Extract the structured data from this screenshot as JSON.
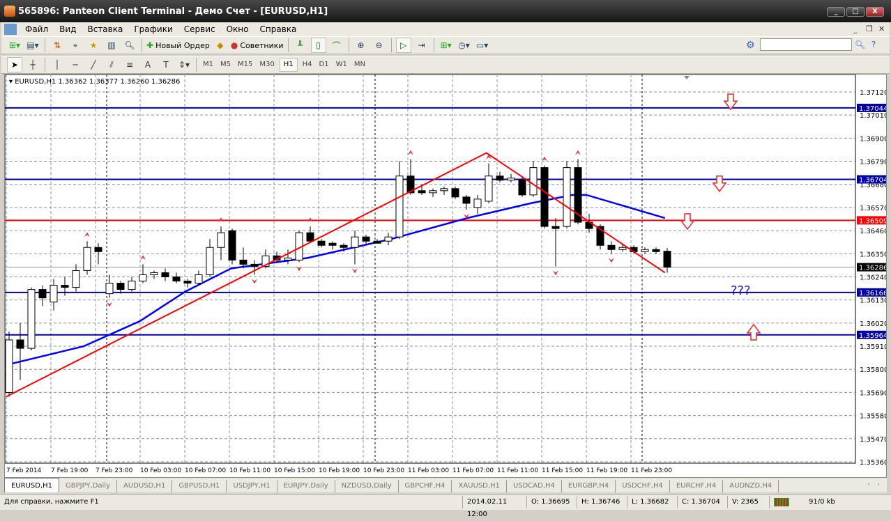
{
  "window": {
    "title": "565896: Panteon Client Terminal - Демо Счет - [EURUSD,H1]",
    "min": "_",
    "max": "□",
    "close": "X"
  },
  "menu": [
    "Файл",
    "Вид",
    "Вставка",
    "Графики",
    "Сервис",
    "Окно",
    "Справка"
  ],
  "toolbar": {
    "new_order": "Новый Ордер",
    "experts": "Советники"
  },
  "timeframes": [
    "M1",
    "M5",
    "M15",
    "M30",
    "H1",
    "H4",
    "D1",
    "W1",
    "MN"
  ],
  "active_timeframe": "H1",
  "chart_header": "EURUSD,H1  1.36362 1.36377 1.36260 1.36286",
  "question_text": "???",
  "tabs": [
    "EURUSD,H1",
    "GBPJPY,Daily",
    "AUDUSD,H1",
    "GBPUSD,H1",
    "USDJPY,H1",
    "EURJPY,Daily",
    "NZDUSD,Daily",
    "GBPCHF,H4",
    "XAUUSD,H1",
    "USDCAD,H4",
    "EURGBP,H4",
    "USDCHF,H4",
    "EURCHF,H4",
    "AUDNZD,H4"
  ],
  "status": {
    "help": "Для справки, нажмите F1",
    "time": "2014.02.11 12:00",
    "open": "O: 1.36695",
    "high": "H: 1.36746",
    "low": "L: 1.36682",
    "close": "C: 1.36704",
    "volume": "V: 2365",
    "traffic": "91/0 kb"
  },
  "colors": {
    "bull": "#ffffff",
    "bear": "#000000",
    "ma": "#0000ff",
    "trend": "#ff0000",
    "level_blue": "#0000aa",
    "level_red": "#ff0000"
  },
  "chart_data": {
    "type": "candlestick",
    "symbol": "EURUSD",
    "timeframe": "H1",
    "ylim": [
      1.3533,
      1.372
    ],
    "y_ticks": [
      "1.37120",
      "1.37010",
      "1.36900",
      "1.36790",
      "1.36680",
      "1.36570",
      "1.36460",
      "1.36350",
      "1.36240",
      "1.36130",
      "1.36020",
      "1.35910",
      "1.35800",
      "1.35690",
      "1.35580",
      "1.35470",
      "1.35360"
    ],
    "x_labels": [
      "7 Feb 2014",
      "7 Feb 19:00",
      "7 Feb 23:00",
      "10 Feb 03:00",
      "10 Feb 07:00",
      "10 Feb 11:00",
      "10 Feb 15:00",
      "10 Feb 19:00",
      "10 Feb 23:00",
      "11 Feb 03:00",
      "11 Feb 07:00",
      "11 Feb 11:00",
      "11 Feb 15:00",
      "11 Feb 19:00",
      "11 Feb 23:00"
    ],
    "levels": [
      {
        "price": "1.37044",
        "color": "blue"
      },
      {
        "price": "1.36704",
        "color": "blue"
      },
      {
        "price": "1.36509",
        "color": "red"
      },
      {
        "price": "1.36286",
        "color": "bid"
      },
      {
        "price": "1.36166",
        "color": "blue"
      },
      {
        "price": "1.35964",
        "color": "blue"
      }
    ],
    "ohlc": [
      [
        1.3569,
        1.3598,
        1.3567,
        1.3594
      ],
      [
        1.3594,
        1.3602,
        1.3575,
        1.359
      ],
      [
        1.359,
        1.3619,
        1.3589,
        1.3618
      ],
      [
        1.3618,
        1.362,
        1.361,
        1.3614
      ],
      [
        1.3612,
        1.3623,
        1.3608,
        1.362
      ],
      [
        1.362,
        1.3624,
        1.3615,
        1.3619
      ],
      [
        1.3619,
        1.363,
        1.3617,
        1.3627
      ],
      [
        1.3627,
        1.3641,
        1.3625,
        1.3638
      ],
      [
        1.3638,
        1.364,
        1.363,
        1.3636
      ],
      [
        1.3616,
        1.3625,
        1.3614,
        1.3621
      ],
      [
        1.3621,
        1.3622,
        1.3616,
        1.3618
      ],
      [
        1.3618,
        1.3624,
        1.3617,
        1.3622
      ],
      [
        1.3622,
        1.363,
        1.3621,
        1.3625
      ],
      [
        1.3625,
        1.3627,
        1.3623,
        1.3626
      ],
      [
        1.3626,
        1.3628,
        1.3622,
        1.3624
      ],
      [
        1.3624,
        1.3626,
        1.3621,
        1.3622
      ],
      [
        1.3622,
        1.3623,
        1.3619,
        1.3621
      ],
      [
        1.3621,
        1.3627,
        1.362,
        1.3625
      ],
      [
        1.3625,
        1.3642,
        1.3624,
        1.3638
      ],
      [
        1.3638,
        1.3648,
        1.3632,
        1.3645
      ],
      [
        1.3646,
        1.3647,
        1.363,
        1.3632
      ],
      [
        1.3632,
        1.3638,
        1.3628,
        1.363
      ],
      [
        1.363,
        1.3632,
        1.3625,
        1.3629
      ],
      [
        1.3629,
        1.3637,
        1.3628,
        1.3634
      ],
      [
        1.3634,
        1.3636,
        1.3631,
        1.3632
      ],
      [
        1.3632,
        1.3637,
        1.363,
        1.3633
      ],
      [
        1.3632,
        1.3646,
        1.3631,
        1.3645
      ],
      [
        1.3645,
        1.3648,
        1.364,
        1.3641
      ],
      [
        1.3641,
        1.3642,
        1.3638,
        1.3639
      ],
      [
        1.364,
        1.3641,
        1.3637,
        1.3639
      ],
      [
        1.3639,
        1.364,
        1.3636,
        1.3638
      ],
      [
        1.3638,
        1.3646,
        1.363,
        1.3643
      ],
      [
        1.3643,
        1.3644,
        1.3639,
        1.3641
      ],
      [
        1.3641,
        1.3642,
        1.364,
        1.364
      ],
      [
        1.3641,
        1.3645,
        1.3639,
        1.3643
      ],
      [
        1.3643,
        1.3679,
        1.3642,
        1.3672
      ],
      [
        1.3672,
        1.368,
        1.3663,
        1.3664
      ],
      [
        1.3665,
        1.3668,
        1.3663,
        1.3664
      ],
      [
        1.3664,
        1.3666,
        1.3662,
        1.3665
      ],
      [
        1.3665,
        1.3667,
        1.3663,
        1.3666
      ],
      [
        1.3666,
        1.3667,
        1.3661,
        1.3662
      ],
      [
        1.3662,
        1.3663,
        1.3656,
        1.3659
      ],
      [
        1.3657,
        1.3663,
        1.3654,
        1.3661
      ],
      [
        1.366,
        1.3678,
        1.3659,
        1.3672
      ],
      [
        1.3672,
        1.3674,
        1.3669,
        1.367
      ],
      [
        1.367,
        1.3673,
        1.3669,
        1.3671
      ],
      [
        1.367,
        1.3672,
        1.3662,
        1.3663
      ],
      [
        1.3663,
        1.3679,
        1.3662,
        1.3676
      ],
      [
        1.3676,
        1.3677,
        1.3647,
        1.3648
      ],
      [
        1.3648,
        1.3652,
        1.3629,
        1.3647
      ],
      [
        1.3648,
        1.3679,
        1.3647,
        1.3676
      ],
      [
        1.3676,
        1.368,
        1.3649,
        1.365
      ],
      [
        1.365,
        1.3654,
        1.3645,
        1.3647
      ],
      [
        1.3648,
        1.3649,
        1.3637,
        1.3639
      ],
      [
        1.3639,
        1.3641,
        1.3635,
        1.3637
      ],
      [
        1.3637,
        1.364,
        1.3636,
        1.3638
      ],
      [
        1.3638,
        1.3639,
        1.3635,
        1.3636
      ],
      [
        1.3636,
        1.3638,
        1.3635,
        1.3637
      ],
      [
        1.3637,
        1.3638,
        1.3635,
        1.3636
      ],
      [
        1.36362,
        1.36377,
        1.3626,
        1.36286
      ]
    ],
    "ma": [
      [
        -0.3,
        1.3582
      ],
      [
        6.7,
        1.3591
      ],
      [
        11.75,
        1.3603
      ],
      [
        15.8,
        1.3617
      ],
      [
        19.9,
        1.3628
      ],
      [
        26.75,
        1.3633
      ],
      [
        34.25,
        1.3642
      ],
      [
        41.1,
        1.3652
      ],
      [
        46.75,
        1.3659
      ],
      [
        50.5,
        1.3663
      ],
      [
        51.75,
        1.3663
      ],
      [
        58.8,
        1.3652
      ]
    ],
    "trendline": [
      [
        -0.25,
        1.3567
      ],
      [
        42.8,
        1.3683
      ],
      [
        58.8,
        1.3626
      ]
    ],
    "fractals_up": [
      7,
      12,
      19,
      27,
      36,
      43,
      48,
      51
    ],
    "fractals_down": [
      9,
      22,
      26,
      31,
      41,
      49,
      54
    ],
    "big_arrows": [
      {
        "dir": "down",
        "price": 1.3707
      },
      {
        "dir": "down",
        "price": 1.3668
      },
      {
        "dir": "down",
        "price": 1.365
      },
      {
        "dir": "up",
        "price": 1.3598
      }
    ]
  }
}
